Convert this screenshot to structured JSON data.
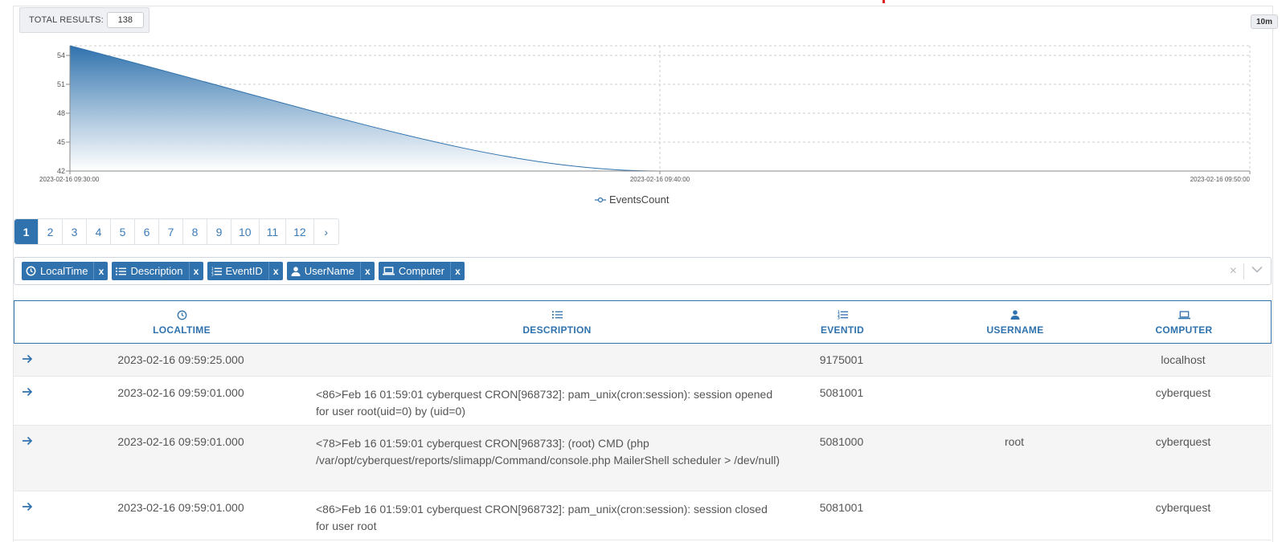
{
  "summary": {
    "total_label": "TOTAL RESULTS:",
    "total_value": "138"
  },
  "time_range": {
    "label": "10m"
  },
  "chart_data": {
    "type": "area",
    "x": [
      "2023-02-16 09:30:00",
      "2023-02-16 09:40:00",
      "2023-02-16 09:50:00"
    ],
    "series": [
      {
        "name": "EventsCount",
        "values": [
          55,
          42,
          42
        ]
      }
    ],
    "ylim": [
      42,
      55
    ],
    "yticks": [
      42,
      45,
      48,
      51,
      54
    ],
    "xticks": [
      "2023-02-16 09:30:00",
      "2023-02-16 09:40:00",
      "2023-02-16 09:50:00"
    ],
    "grid": true,
    "legend": "bottom-center",
    "colors": {
      "series": "#2f72ad",
      "fill_top": "#2f72ad",
      "fill_bottom": "#ffffff",
      "grid": "#cccccc"
    }
  },
  "pagination": {
    "pages": [
      "1",
      "2",
      "3",
      "4",
      "5",
      "6",
      "7",
      "8",
      "9",
      "10",
      "11",
      "12"
    ],
    "active": "1",
    "next": "›"
  },
  "filters": {
    "chips": [
      {
        "label": "LocalTime",
        "icon": "clock-icon",
        "remove": "x"
      },
      {
        "label": "Description",
        "icon": "list-icon",
        "remove": "x"
      },
      {
        "label": "EventID",
        "icon": "ordered-list-icon",
        "remove": "x"
      },
      {
        "label": "UserName",
        "icon": "user-icon",
        "remove": "x"
      },
      {
        "label": "Computer",
        "icon": "laptop-icon",
        "remove": "x"
      }
    ],
    "clear": "×"
  },
  "table": {
    "headers": {
      "localtime": "LOCALTIME",
      "description": "DESCRIPTION",
      "eventid": "EVENTID",
      "username": "USERNAME",
      "computer": "COMPUTER"
    },
    "rows": [
      {
        "arrow": "→",
        "localtime": "2023-02-16 09:59:25.000",
        "description": "",
        "eventid": "9175001",
        "username": "",
        "computer": "localhost"
      },
      {
        "arrow": "→",
        "localtime": "2023-02-16 09:59:01.000",
        "description": "<86>Feb 16 01:59:01 cyberquest CRON[968732]: pam_unix(cron:session): session opened for user root(uid=0) by (uid=0)",
        "eventid": "5081001",
        "username": "",
        "computer": "cyberquest"
      },
      {
        "arrow": "→",
        "localtime": "2023-02-16 09:59:01.000",
        "description": "<78>Feb 16 01:59:01 cyberquest CRON[968733]: (root) CMD (php /var/opt/cyberquest/reports/slimapp/Command/console.php MailerShell scheduler > /dev/null)",
        "eventid": "5081000",
        "username": "root",
        "computer": "cyberquest"
      },
      {
        "arrow": "→",
        "localtime": "2023-02-16 09:59:01.000",
        "description": "<86>Feb 16 01:59:01 cyberquest CRON[968732]: pam_unix(cron:session): session closed for user root",
        "eventid": "5081001",
        "username": "",
        "computer": "cyberquest"
      }
    ]
  }
}
